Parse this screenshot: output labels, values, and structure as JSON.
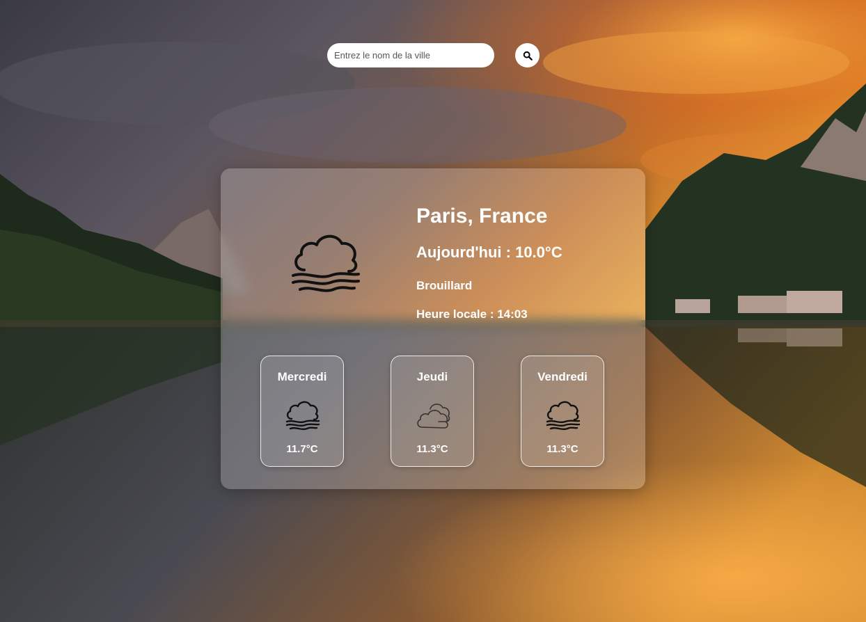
{
  "search": {
    "placeholder": "Entrez le nom de la ville",
    "value": ""
  },
  "search_button": {
    "icon": "search-icon"
  },
  "current": {
    "city": "Paris, France",
    "today": "Aujourd'hui : 10.0°C",
    "condition": "Brouillard",
    "local_time": "Heure locale : 14:03",
    "icon": "fog-icon"
  },
  "forecast": [
    {
      "day": "Mercredi",
      "temp": "11.7°C",
      "icon": "fog-icon"
    },
    {
      "day": "Jeudi",
      "temp": "11.3°C",
      "icon": "cloudy-icon"
    },
    {
      "day": "Vendredi",
      "temp": "11.3°C",
      "icon": "fog-icon"
    }
  ],
  "colors": {
    "text": "#ffffff",
    "icon": "#111111",
    "input_bg": "#ffffff"
  }
}
